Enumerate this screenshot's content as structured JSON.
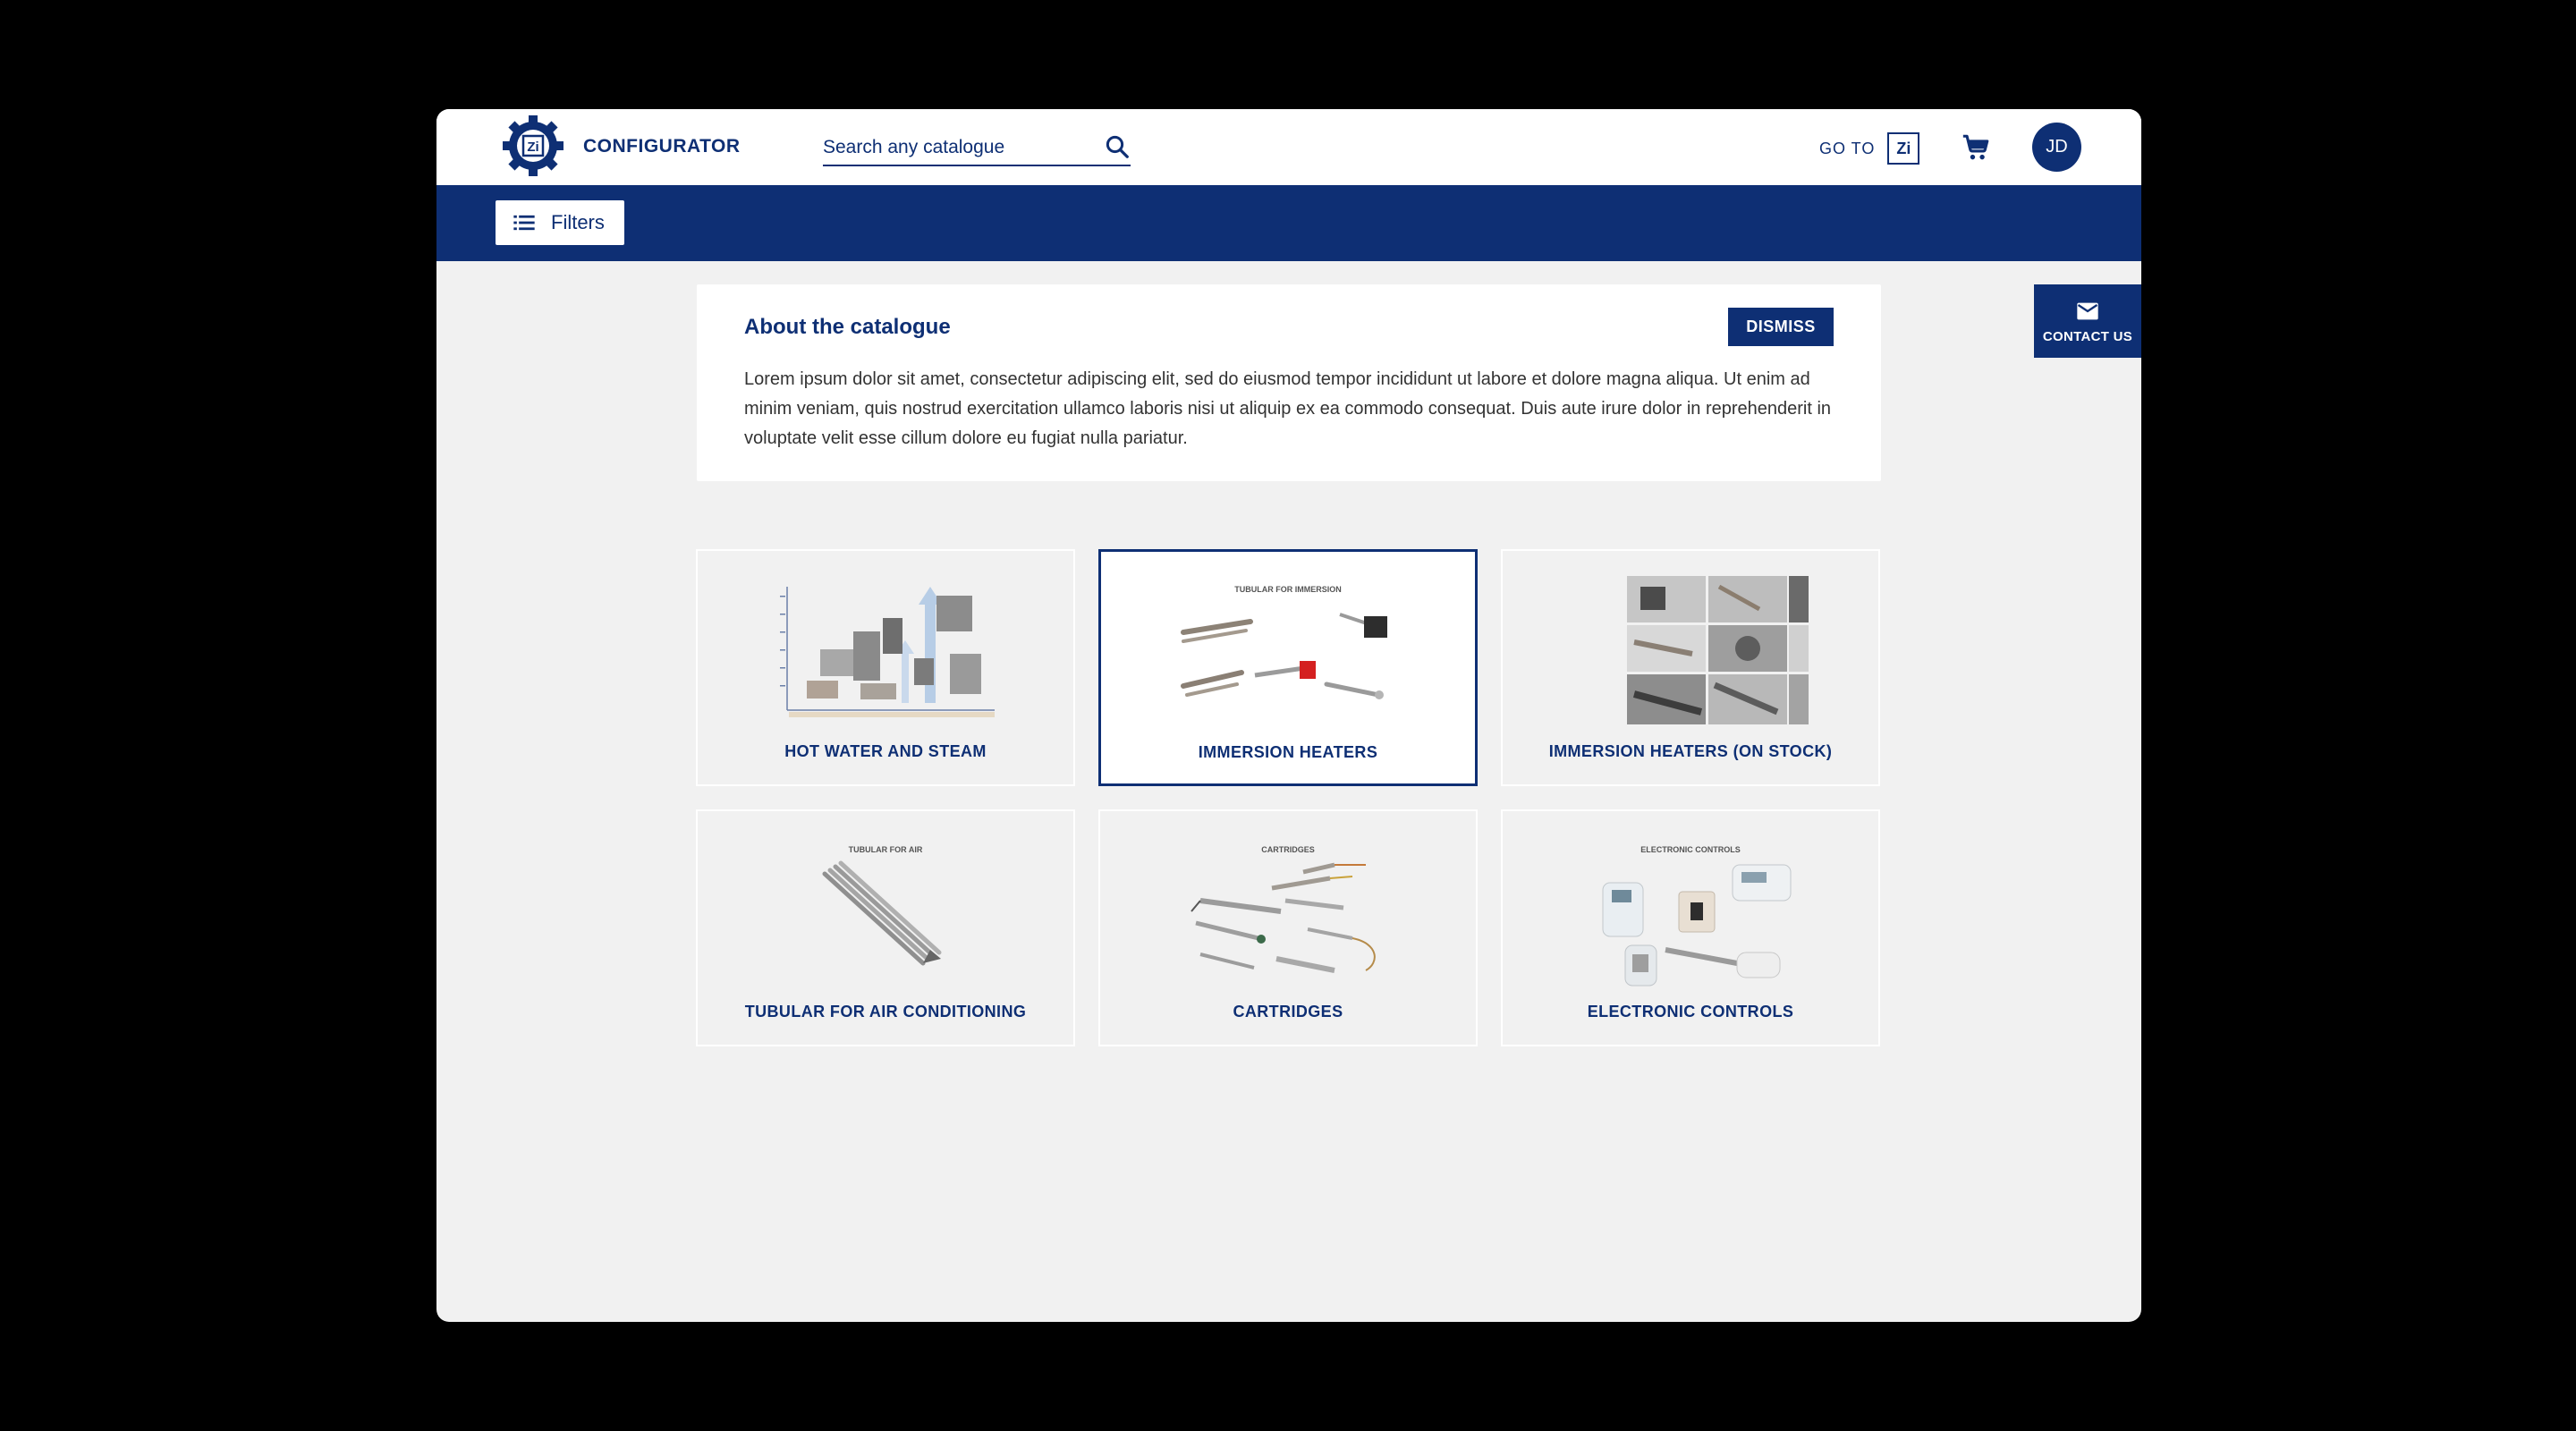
{
  "header": {
    "brand": "CONFIGURATOR",
    "search_placeholder": "Search any catalogue",
    "goto_label": "GO TO",
    "goto_logo": "Zi",
    "user_initials": "JD"
  },
  "navbar": {
    "filters_label": "Filters"
  },
  "about": {
    "title": "About the catalogue",
    "dismiss_label": "DISMISS",
    "body": "Lorem ipsum dolor sit amet, consectetur adipiscing elit, sed do eiusmod tempor incididunt ut labore et dolore magna aliqua. Ut enim ad minim veniam, quis nostrud exercitation ullamco laboris nisi ut aliquip ex ea commodo consequat. Duis aute irure dolor in reprehenderit in voluptate velit esse cillum dolore eu fugiat nulla pariatur."
  },
  "contact": {
    "label": "CONTACT US"
  },
  "catalogues": [
    {
      "label": "HOT WATER AND STEAM",
      "caption": ""
    },
    {
      "label": "IMMERSION HEATERS",
      "caption": "TUBULAR FOR IMMERSION",
      "selected": true
    },
    {
      "label": "IMMERSION HEATERS (ON STOCK)",
      "caption": ""
    },
    {
      "label": "TUBULAR FOR AIR CONDITIONING",
      "caption": "TUBULAR FOR AIR"
    },
    {
      "label": "CARTRIDGES",
      "caption": "CARTRIDGES"
    },
    {
      "label": "ELECTRONIC CONTROLS",
      "caption": "ELECTRONIC CONTROLS"
    }
  ],
  "colors": {
    "primary": "#0e2f74",
    "background": "#f1f1f1",
    "surface": "#ffffff"
  },
  "icons": [
    "gear-logo-icon",
    "search-icon",
    "zi-logo-icon",
    "cart-icon",
    "list-icon",
    "mail-icon"
  ]
}
